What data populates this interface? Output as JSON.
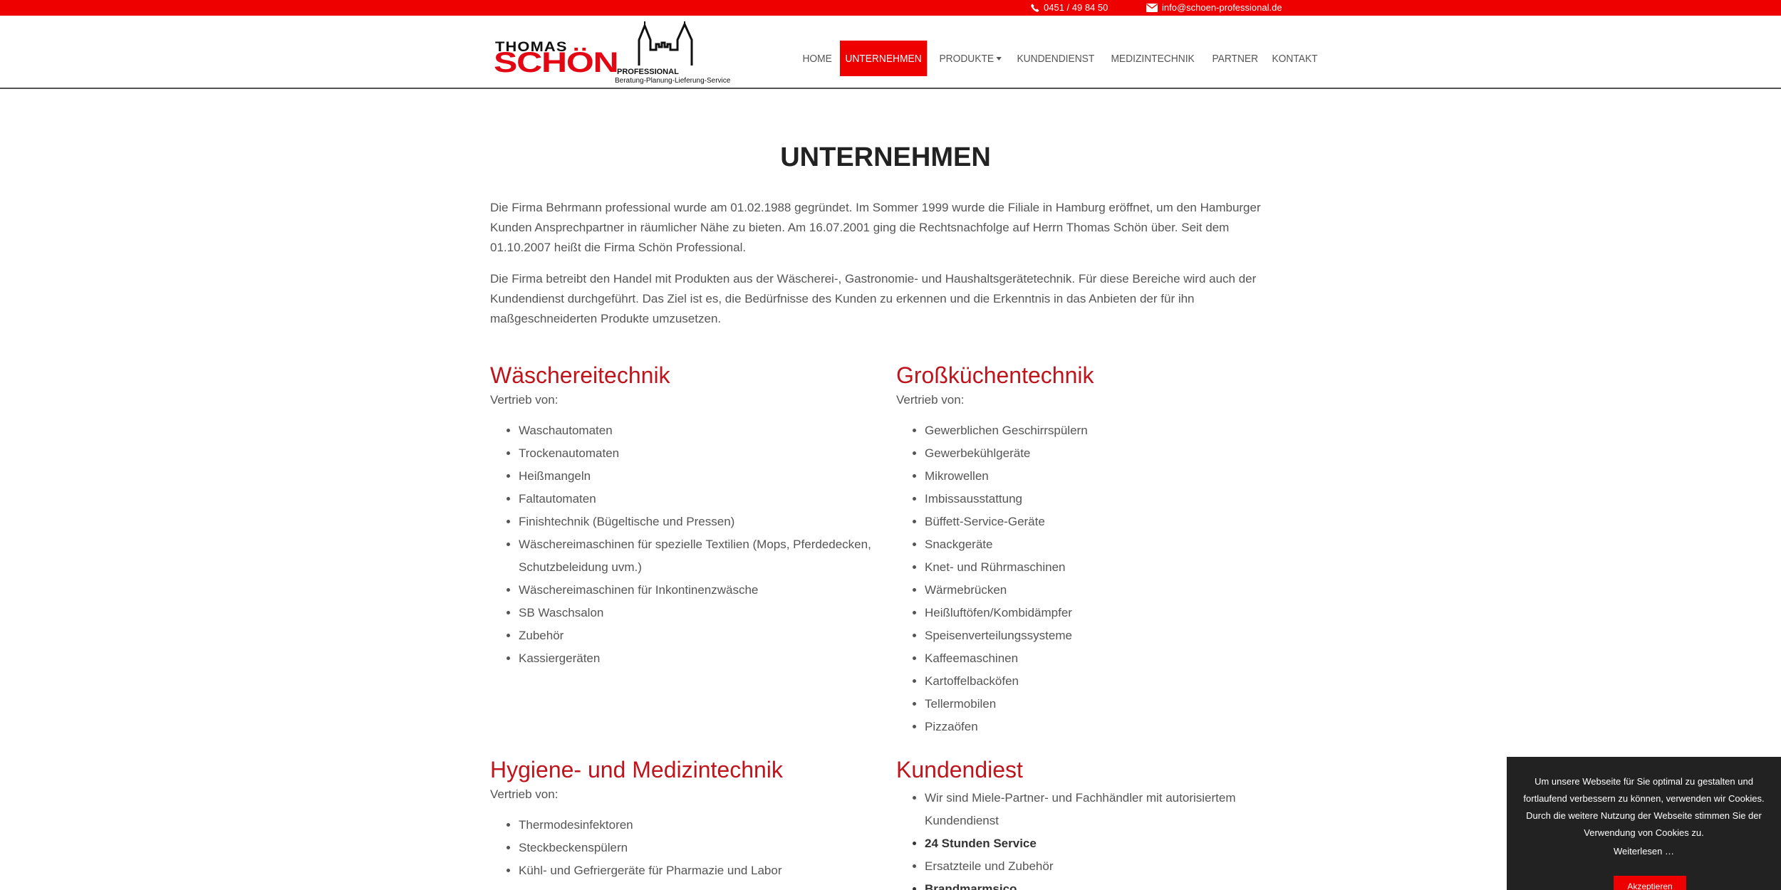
{
  "topbar": {
    "phone": "0451 / 49 84 50",
    "email": "info@schoen-professional.de",
    "phone_icon": "phone-icon",
    "mail_icon": "mail-icon",
    "color": "#ee0000"
  },
  "logo": {
    "line1": "THOMAS",
    "line2": "SCHÖN",
    "line3": "PROFESSIONAL",
    "tagline": "Beratung-Planung-Lieferung-Service"
  },
  "nav": {
    "items": [
      {
        "label": "HOME",
        "active": false
      },
      {
        "label": "UNTERNEHMEN",
        "active": true
      },
      {
        "label": "PRODUKTE",
        "active": false,
        "dropdown": true
      },
      {
        "label": "KUNDENDIENST",
        "active": false
      },
      {
        "label": "MEDIZINTECHNIK",
        "active": false
      },
      {
        "label": "PARTNER",
        "active": false
      },
      {
        "label": "KONTAKT",
        "active": false
      }
    ]
  },
  "page": {
    "title": "UNTERNEHMEN",
    "paragraphs": [
      "Die Firma Behrmann professional wurde am 01.02.1988 gegründet. Im Sommer 1999 wurde die Filiale in Hamburg eröffnet, um den Hamburger Kunden Ansprechpartner in räumlicher Nähe zu bieten. Am 16.07.2001 ging die Rechtsnachfolge auf Herrn Thomas Schön über. Seit dem 01.10.2007 heißt die Firma Schön Professional.",
      "Die Firma betreibt den Handel mit Produkten aus der Wäscherei-, Gastronomie- und Haushaltsgerätetechnik. Für diese Bereiche wird auch der Kundendienst durchgeführt. Das Ziel ist es, die Bedürfnisse des Kunden zu erkennen und die Erkenntnis in das Anbieten der für ihn maßgeschneiderten Produkte umzusetzen."
    ],
    "heading_color": "#c0141c"
  },
  "sections": [
    {
      "title": "Wäschereitechnik",
      "subtitle": "Vertrieb von:",
      "items": [
        "Waschautomaten",
        "Trockenautomaten",
        "Heißmangeln",
        "Faltautomaten",
        "Finishtechnik (Bügeltische und Pressen)",
        "Wäschereimaschinen für spezielle Textilien (Mops, Pferdedecken, Schutzbeleidung uvm.)",
        "Wäschereimaschinen für Inkontinenzwäsche",
        "SB Waschsalon",
        "Zubehör",
        "Kassiergeräten"
      ]
    },
    {
      "title": "Großküchentechnik",
      "subtitle": "Vertrieb von:",
      "items": [
        "Gewerblichen Geschirrspülern",
        "Gewerbekühlgeräte",
        "Mikrowellen",
        "Imbissausstattung",
        "Büffett-Service-Geräte",
        "Snackgeräte",
        "Knet- und Rührmaschinen",
        "Wärmebrücken",
        "Heißluftöfen/Kombidämpfer",
        "Speisenverteilungssysteme",
        "Kaffeemaschinen",
        "Kartoffelbacköfen",
        "Tellermobilen",
        "Pizzaöfen"
      ]
    },
    {
      "title": "Hygiene- und Medizintechnik",
      "subtitle": "Vertrieb von:",
      "items": [
        "Thermodesinfektoren",
        "Steckbeckenspülern",
        "Kühl- und Gefriergeräte für Pharmazie und Labor"
      ]
    },
    {
      "title": "Kundendiest",
      "items": [
        {
          "text": "Wir sind Miele-Partner- und Fachhändler mit autorisiertem Kundendienst",
          "bold": false
        },
        {
          "text": "24 Stunden Service",
          "bold": true
        },
        {
          "text": "Ersatzteile und Zubehör",
          "bold": false
        },
        {
          "text": "Brandmarmsico",
          "bold": true
        }
      ]
    }
  ],
  "cookie": {
    "message": "Um unsere Webseite für Sie optimal zu gestalten und fortlaufend verbessern zu können, verwenden wir Cookies. Durch die weitere Nutzung der Webseite stimmen Sie der Verwendung von Cookies zu.",
    "more_link": "Weiterlesen …",
    "accept_button": "Akzeptieren"
  }
}
